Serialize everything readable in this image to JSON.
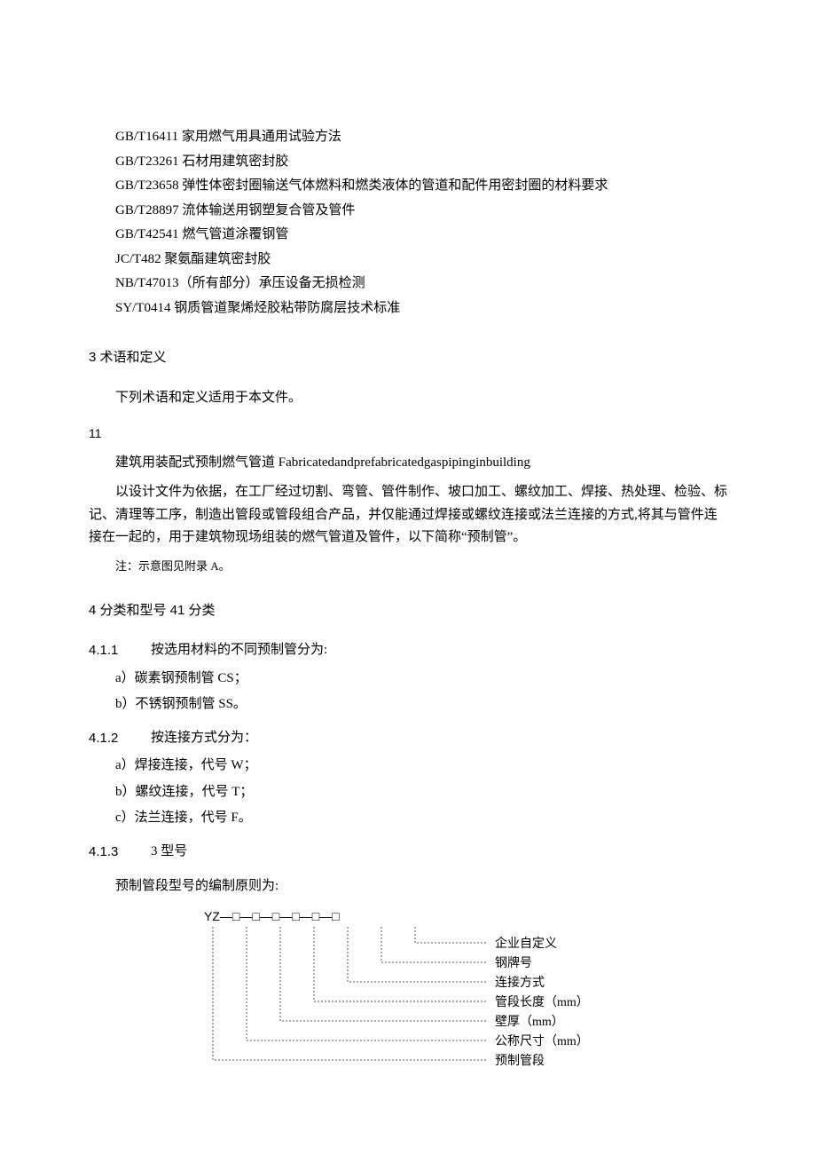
{
  "standards": [
    "GB/T16411 家用燃气用具通用试验方法",
    "GB/T23261 石材用建筑密封胶",
    "GB/T23658 弹性体密封圈输送气体燃料和燃类液体的管道和配件用密封圈的材料要求",
    "GB/T28897 流体输送用钢塑复合管及管件",
    "GB/T42541 燃气管道涂覆钢管",
    "JC/T482 聚氨酯建筑密封胶",
    "NB/T47013（所有部分）承压设备无损检测",
    "SY/T0414 钢质管道聚烯烃胶粘带防腐层技术标准"
  ],
  "sec3_title": "3 术语和定义",
  "sec3_intro": "下列术语和定义适用于本文件。",
  "clause11_num": "11",
  "term_cn": "建筑用装配式预制燃气管道 Fabricatedandprefabricatedgaspipinginbuilding",
  "term_def": "以设计文件为依据，在工厂经过切割、弯管、管件制作、坡口加工、螺纹加工、焊接、热处理、检验、标记、清理等工序，制造出管段或管段组合产品，并仅能通过焊接或螺纹连接或法兰连接的方式,将其与管件连接在一起的，用于建筑物现场组装的燃气管道及管件，以下简称“预制管”。",
  "term_note": "注：示意图见附录 A。",
  "sec4_title": "4 分类和型号 41 分类",
  "c411_num": "4.1.1",
  "c411_txt": "按选用材料的不同预制管分为:",
  "c411_opts": [
    "a）碳素钢预制管 CS；",
    "b）不锈钢预制管 SS。"
  ],
  "c412_num": "4.1.2",
  "c412_txt": "按连接方式分为：",
  "c412_opts": [
    "a）焊接连接，代号 W；",
    "b）螺纹连接，代号 T；",
    "c）法兰连接，代号 F。"
  ],
  "c413_num": "4.1.3",
  "c413_txt": "3 型号",
  "model_intro": "预制管段型号的编制原则为:",
  "diagram": {
    "code": "YZ—□—□—□—□—□—□",
    "labels": [
      "企业自定义",
      "钢牌号",
      "连接方式",
      "管段长度（mm）",
      "壁厚（mm）",
      "公称尺寸（mm）",
      "预制管段"
    ]
  }
}
